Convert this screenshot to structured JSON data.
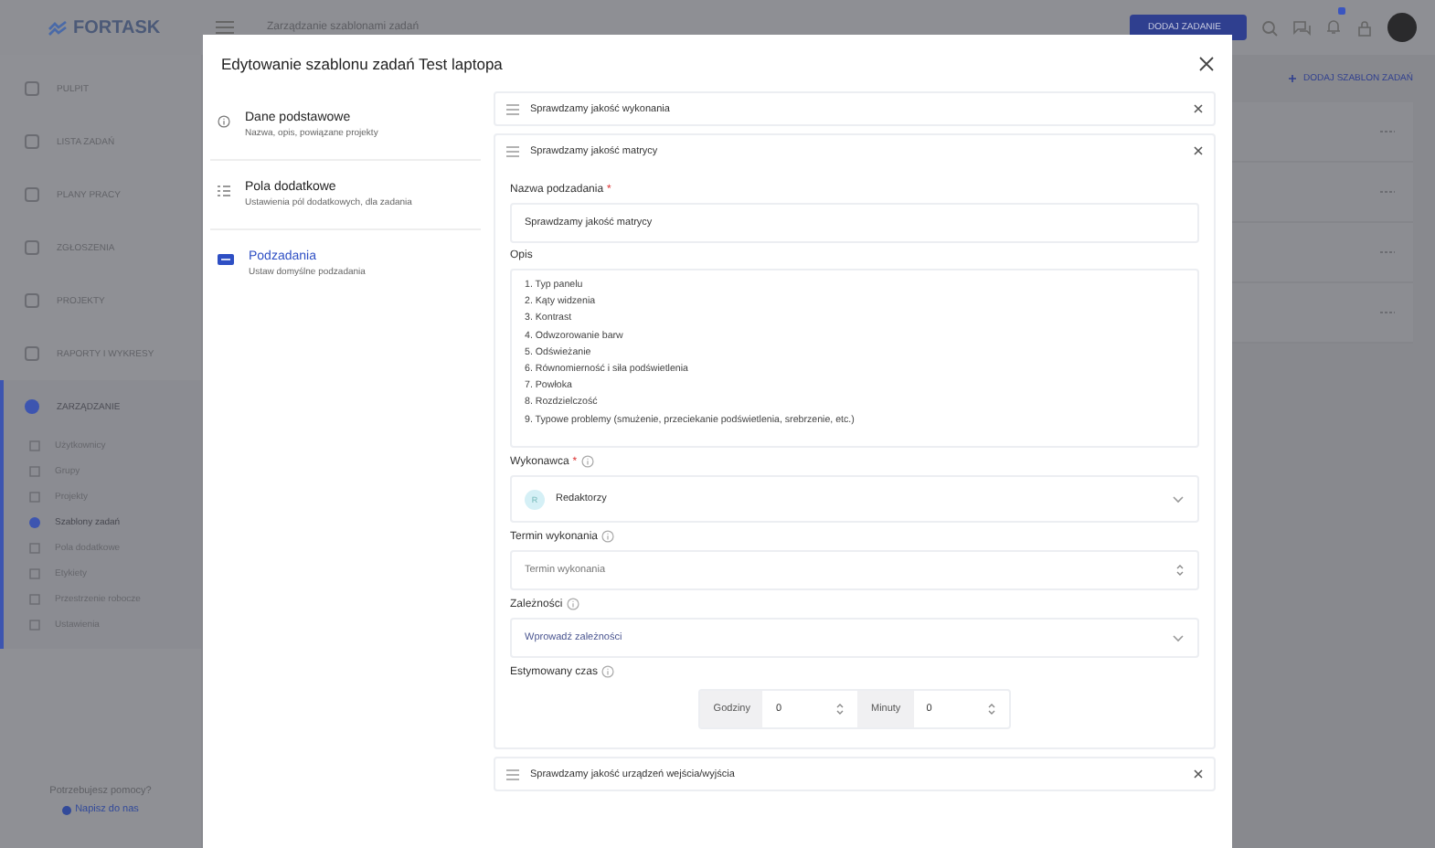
{
  "app": {
    "logo": "FORTASK",
    "page_title": "Zarządzanie szablonami zadań",
    "add_task_button": "DODAJ ZADANIE",
    "add_template_link": "DODAJ SZABLON ZADAŃ"
  },
  "sidebar": {
    "items": [
      {
        "label": "PULPIT",
        "selected": false
      },
      {
        "label": "LISTA ZADAŃ",
        "selected": false
      },
      {
        "label": "PLANY PRACY",
        "selected": false
      },
      {
        "label": "ZGŁOSZENIA",
        "selected": false
      },
      {
        "label": "PROJEKTY",
        "selected": false
      },
      {
        "label": "RAPORTY I WYKRESY",
        "selected": false
      },
      {
        "label": "ZARZĄDZANIE",
        "selected": true
      }
    ],
    "sub_items": [
      {
        "label": "Użytkownicy",
        "selected": false
      },
      {
        "label": "Grupy",
        "selected": false
      },
      {
        "label": "Projekty",
        "selected": false
      },
      {
        "label": "Szablony zadań",
        "selected": true
      },
      {
        "label": "Pola dodatkowe",
        "selected": false
      },
      {
        "label": "Etykiety",
        "selected": false
      },
      {
        "label": "Przestrzenie robocze",
        "selected": false
      },
      {
        "label": "Ustawienia",
        "selected": false
      }
    ],
    "help_text": "Potrzebujesz pomocy?",
    "help_link": "Napisz do nas"
  },
  "modal": {
    "title": "Edytowanie szablonu zadań Test laptopa",
    "nav": [
      {
        "title": "Dane podstawowe",
        "subtitle": "Nazwa, opis, powiązane projekty",
        "selected": false
      },
      {
        "title": "Pola dodatkowe",
        "subtitle": "Ustawienia pól dodatkowych, dla zadania",
        "selected": false
      },
      {
        "title": "Podzadania",
        "subtitle": "Ustaw domyślne podzadania",
        "selected": true
      }
    ],
    "subtasks": [
      {
        "title": "Sprawdzamy jakość wykonania",
        "expanded": false
      },
      {
        "title": "Sprawdzamy jakość matrycy",
        "expanded": true
      },
      {
        "title": "Sprawdzamy jakość urządzeń wejścia/wyjścia",
        "expanded": false
      }
    ],
    "form": {
      "name": {
        "label": "Nazwa podzadania",
        "required_mark": "*",
        "value": "Sprawdzamy jakość matrycy"
      },
      "description": {
        "label": "Opis",
        "value": "1. Typ panelu\n2. Kąty widzenia\n3. Kontrast\n4. Odwzorowanie barw\n5. Odświeżanie\n6. Równomierność i siła podświetlenia\n7. Powłoka\n8. Rozdzielczość\n9. Typowe problemy (smużenie, przeciekanie podświetlenia, srebrzenie, etc.)"
      },
      "assignee": {
        "label": "Wykonawca",
        "required_mark": "*",
        "info": true,
        "initials": "R",
        "value": "Redaktorzy"
      },
      "deadline": {
        "label": "Termin wykonania",
        "info": true,
        "placeholder": "Termin wykonania"
      },
      "dependencies": {
        "label": "Zależności",
        "info": true,
        "placeholder": "Wprowadź zależności"
      },
      "estimate": {
        "label": "Estymowany czas",
        "info": true,
        "hours_label": "Godziny",
        "hours": "0",
        "minutes_label": "Minuty",
        "minutes": "0"
      }
    }
  }
}
